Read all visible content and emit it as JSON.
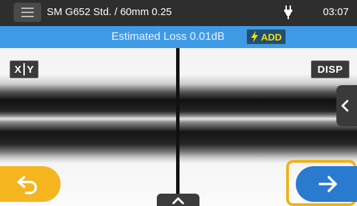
{
  "status_bar": {
    "title": "SM G652 Std. / 60mm 0.25",
    "time": "03:07",
    "power_icon": "plug-icon"
  },
  "loss_banner": {
    "text": "Estimated Loss  0.01dB",
    "add_label": "ADD",
    "add_icon": "lightning-icon"
  },
  "view_controls": {
    "xy_x": "X",
    "xy_y": "Y",
    "disp_label": "DISP"
  },
  "colors": {
    "accent_blue": "#3f9ae6",
    "next_blue": "#2a7ad0",
    "back_yellow": "#f5b51e",
    "highlight": "#f0b21a",
    "add_text": "#ffe000"
  },
  "navigation": {
    "back_icon": "return-arrow-icon",
    "next_icon": "arrow-right-icon",
    "up_icon": "chevron-up-icon",
    "side_icon": "chevron-left-icon"
  }
}
